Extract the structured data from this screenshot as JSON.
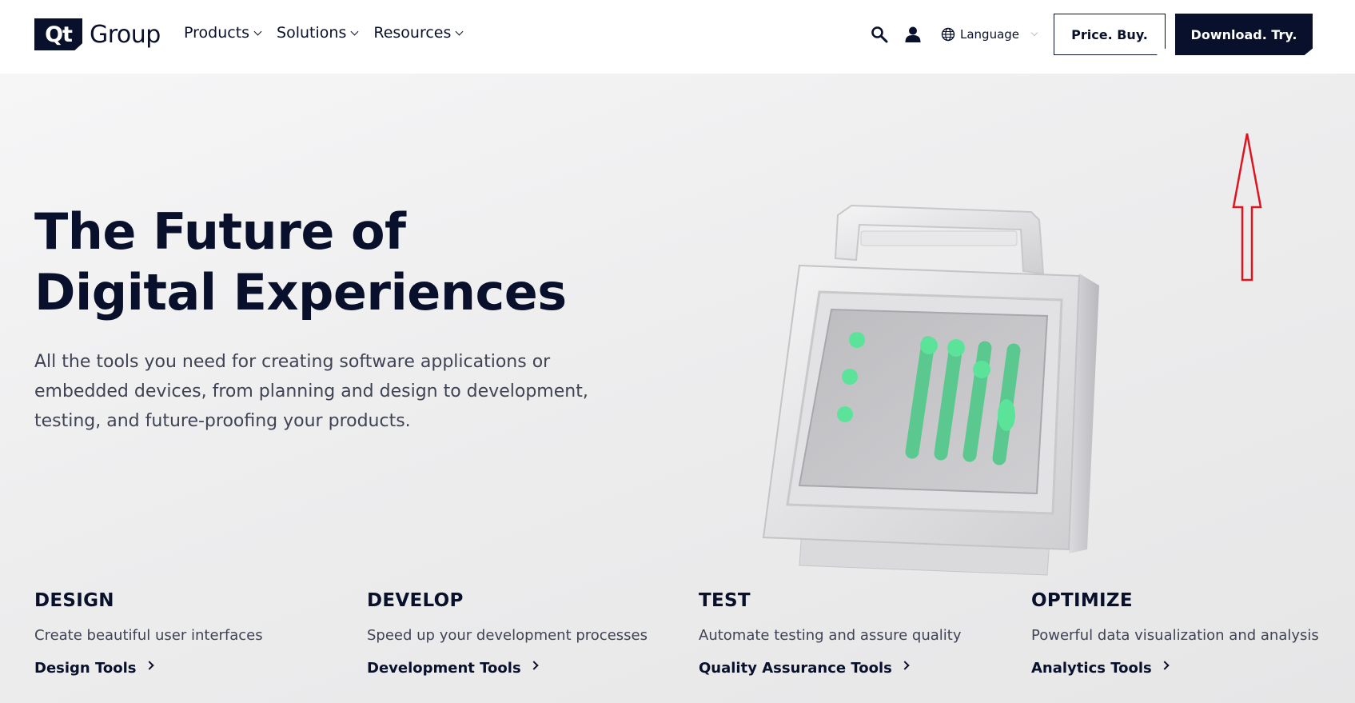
{
  "header": {
    "logo_mark": "Qt",
    "logo_text": "Group",
    "nav": [
      {
        "label": "Products"
      },
      {
        "label": "Solutions"
      },
      {
        "label": "Resources"
      }
    ],
    "language_label": "Language",
    "price_button": "Price. Buy.",
    "download_button": "Download. Try."
  },
  "hero": {
    "title_line1": "The Future of",
    "title_line2": "Digital Experiences",
    "description": "All the tools you need for creating software applications or embedded devices, from planning and design to development, testing, and future-proofing your products."
  },
  "cards": [
    {
      "title": "DESIGN",
      "description": "Create beautiful user interfaces",
      "link": "Design Tools"
    },
    {
      "title": "DEVELOP",
      "description": "Speed up your development processes",
      "link": "Development Tools"
    },
    {
      "title": "TEST",
      "description": "Automate testing and assure quality",
      "link": "Quality Assurance Tools"
    },
    {
      "title": "OPTIMIZE",
      "description": "Powerful data visualization and analysis",
      "link": "Analytics Tools"
    }
  ],
  "colors": {
    "brand_dark": "#09102b",
    "accent_green": "#5ce39a",
    "annotation_red": "#e0141e"
  },
  "icons": [
    "search-icon",
    "user-icon",
    "globe-icon",
    "chevron-down-icon",
    "chevron-right-icon"
  ]
}
